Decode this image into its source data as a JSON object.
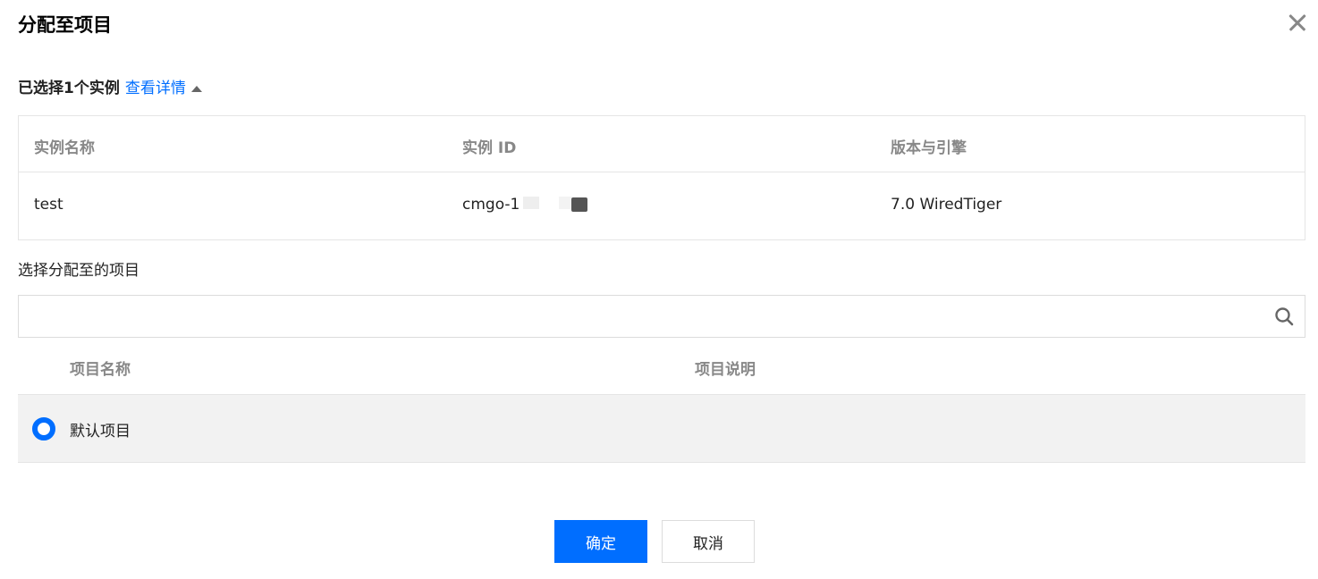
{
  "dialog": {
    "title": "分配至项目",
    "close_icon": "close-icon"
  },
  "selection": {
    "summary": "已选择1个实例",
    "view_details": "查看详情",
    "caret_icon": "caret-up-icon"
  },
  "instance_table": {
    "columns": [
      "实例名称",
      "实例 ID",
      "版本与引擎"
    ],
    "rows": [
      {
        "name": "test",
        "id": "cmgo-1",
        "version": "7.0 WiredTiger"
      }
    ]
  },
  "assign": {
    "label": "选择分配至的项目",
    "search_placeholder": "",
    "search_value": "",
    "search_icon": "search-icon"
  },
  "project_table": {
    "columns": [
      "项目名称",
      "项目说明"
    ],
    "rows": [
      {
        "name": "默认项目",
        "description": "",
        "selected": true
      }
    ]
  },
  "footer": {
    "ok_label": "确定",
    "cancel_label": "取消"
  },
  "colors": {
    "accent": "#006eff",
    "row_selected_bg": "#f2f2f2",
    "border": "#e5e5e5"
  }
}
